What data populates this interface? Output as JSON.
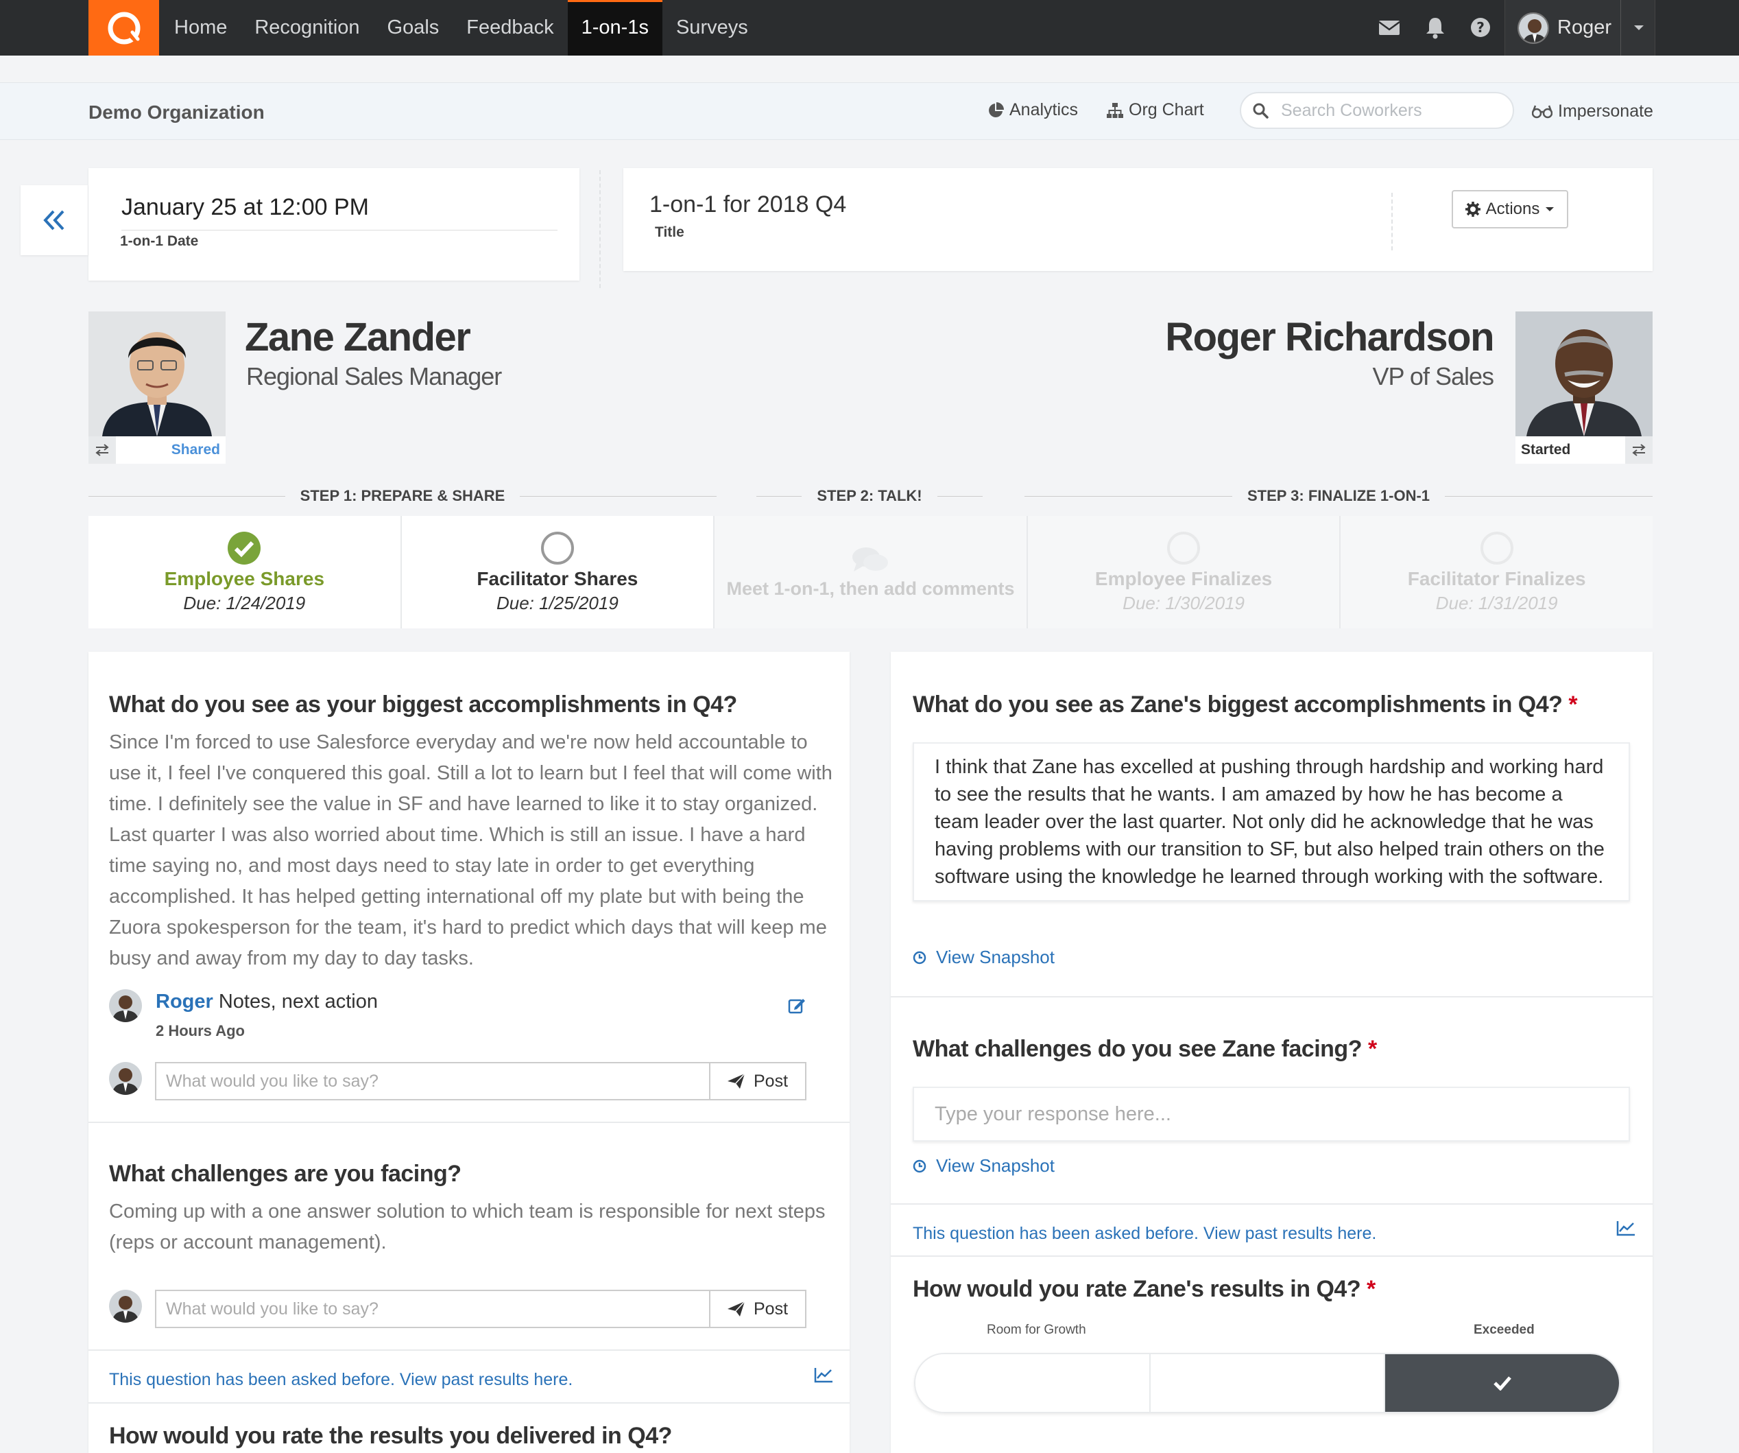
{
  "nav": {
    "items": [
      {
        "label": "Home",
        "active": false
      },
      {
        "label": "Recognition",
        "active": false
      },
      {
        "label": "Goals",
        "active": false
      },
      {
        "label": "Feedback",
        "active": false
      },
      {
        "label": "1-on-1s",
        "active": true
      },
      {
        "label": "Surveys",
        "active": false
      }
    ],
    "user_name": "Roger",
    "accent_color": "#ff6a13"
  },
  "subheader": {
    "org_name": "Demo Organization",
    "analytics_label": "Analytics",
    "org_chart_label": "Org Chart",
    "search_placeholder": "Search Coworkers",
    "impersonate_label": "Impersonate"
  },
  "meeting": {
    "date_value": "January 25 at 12:00 PM",
    "date_label": "1-on-1 Date",
    "title_value": "1-on-1 for 2018 Q4",
    "title_label": "Title",
    "actions_label": "Actions"
  },
  "employee": {
    "name": "Zane Zander",
    "role": "Regional Sales Manager",
    "status": "Shared"
  },
  "facilitator": {
    "name": "Roger Richardson",
    "role": "VP of Sales",
    "status": "Started"
  },
  "step_headers": [
    "STEP 1: PREPARE & SHARE",
    "STEP 2: TALK!",
    "STEP 3: FINALIZE 1-ON-1"
  ],
  "steps": [
    {
      "name": "Employee Shares",
      "due": "Due: 1/24/2019",
      "state": "done"
    },
    {
      "name": "Facilitator Shares",
      "due": "Due: 1/25/2019",
      "state": "pending"
    },
    {
      "name": "Meet 1-on-1, then add comments",
      "due": "",
      "state": "disabled"
    },
    {
      "name": "Employee Finalizes",
      "due": "Due: 1/30/2019",
      "state": "disabled"
    },
    {
      "name": "Facilitator Finalizes",
      "due": "Due: 1/31/2019",
      "state": "disabled"
    }
  ],
  "left": {
    "q1": {
      "title": "What do you see as your biggest accomplishments in Q4?",
      "answer": "Since I'm forced to use Salesforce everyday and we're now held accountable to use it, I feel I've conquered this goal. Still a lot to learn but I feel that will come with time. I definitely see the value in SF and have learned to like it to stay organized. Last quarter I was also worried about time. Which is still an issue. I have a hard time saying no, and most days need to stay late in order to get everything accomplished. It has helped getting international off my plate but with being the Zuora spokesperson for the team, it's hard to predict which days that will keep me busy and away from my day to day tasks.",
      "comment_author": "Roger",
      "comment_text": "Notes, next action",
      "comment_time": "2 Hours Ago",
      "input_placeholder": "What would you like to say?",
      "post_label": "Post"
    },
    "q2": {
      "title": "What challenges are you facing?",
      "answer": "Coming up with a one answer solution to which team is responsible for next steps (reps or account management).",
      "input_placeholder": "What would you like to say?",
      "post_label": "Post"
    },
    "asked_before": "This question has been asked before. View past results here.",
    "q3_title": "How would you rate the results you delivered in Q4?"
  },
  "right": {
    "q1": {
      "title": "What do you see as Zane's biggest accomplishments in Q4?",
      "required_mark": "*",
      "response": "I think that Zane has excelled at pushing through hardship and working hard to see the results that he wants. I am amazed by how he has become a team leader over the last quarter. Not only did he acknowledge that he was having problems with our transition to SF, but also helped train others on the software using the knowledge he learned through working with the software.",
      "snapshot_label": "View Snapshot"
    },
    "q2": {
      "title": "What challenges do you see Zane facing?",
      "required_mark": "*",
      "placeholder": "Type your response here...",
      "snapshot_label": "View Snapshot"
    },
    "asked_before": "This question has been asked before. View past results here.",
    "q3": {
      "title": "How would you rate Zane's results in Q4?",
      "required_mark": "*",
      "low_label": "Room for Growth",
      "high_label": "Exceeded",
      "selected_index": 2,
      "segments": 3
    }
  }
}
